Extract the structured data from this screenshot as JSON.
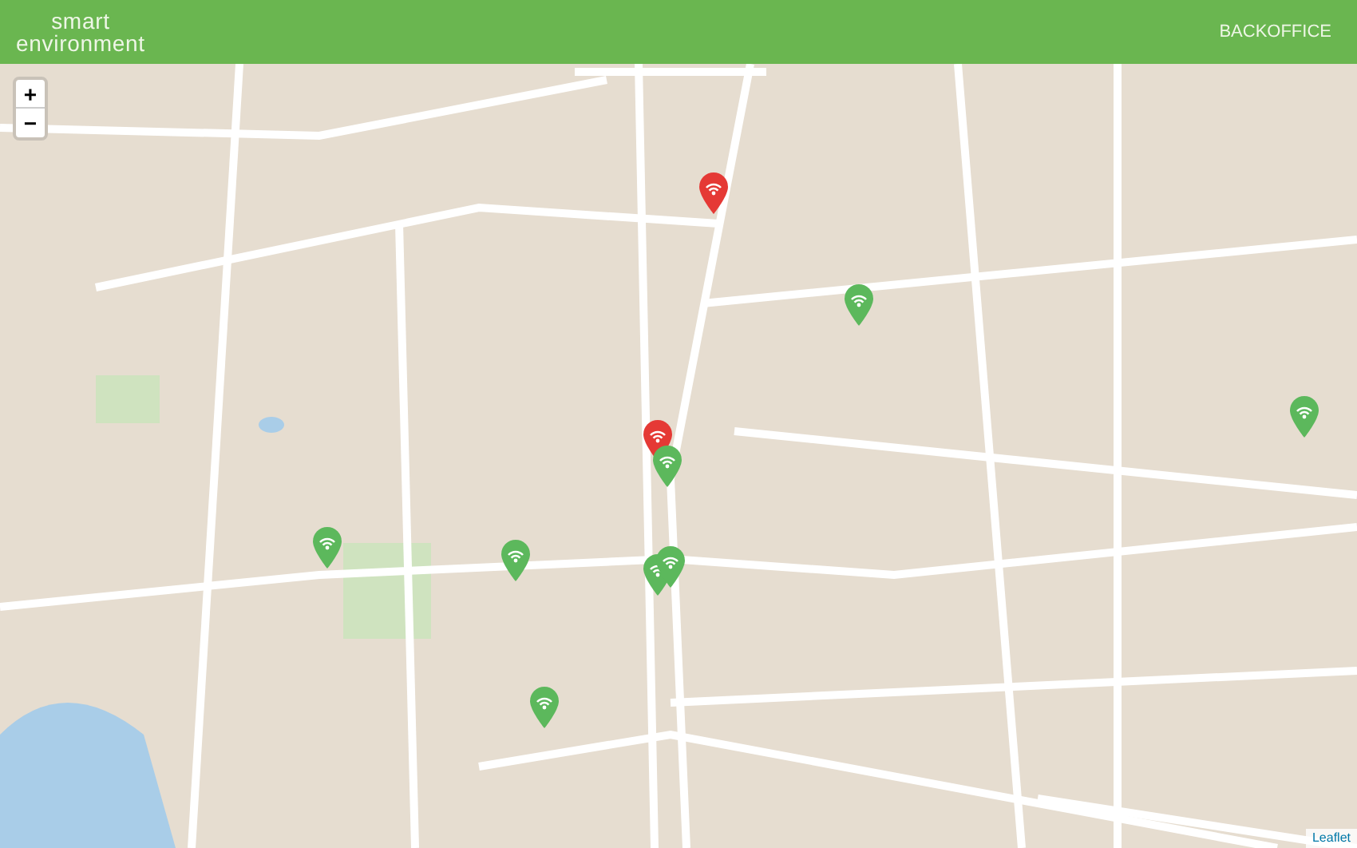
{
  "header": {
    "brand": [
      "smart",
      "environment"
    ],
    "nav": "BACKOFFICE"
  },
  "zoom_controls": [
    "+",
    "−"
  ],
  "markers": [
    {
      "color": "#e53935"
    },
    {
      "color": "#e53935"
    },
    {
      "color": "#5cb85c"
    },
    {
      "color": "#5cb85c"
    },
    {
      "color": "#5cb85c"
    },
    {
      "color": "#5cb85c"
    },
    {
      "color": "#5cb85c"
    },
    {
      "color": "#5cb85c"
    },
    {
      "color": "#5cb85c"
    },
    {
      "color": "#5cb85c"
    }
  ],
  "attribution": "Leaflet"
}
